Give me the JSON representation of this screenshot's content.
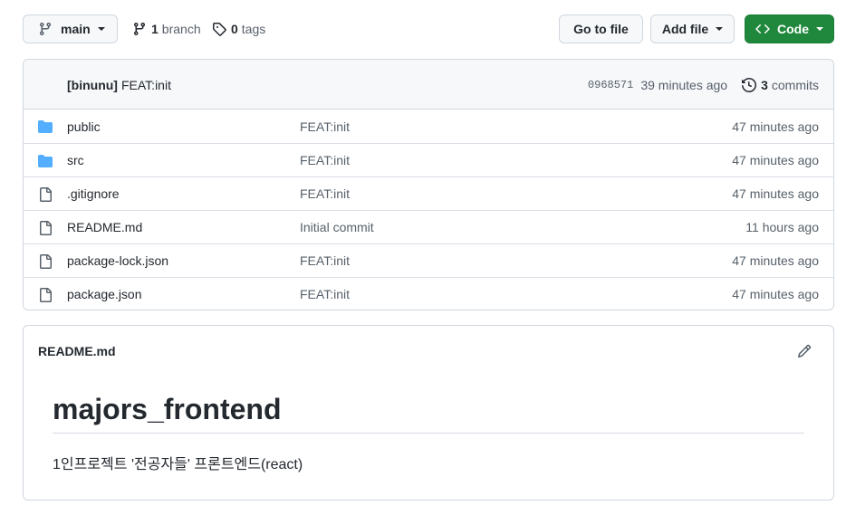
{
  "toolbar": {
    "branch_select": "main",
    "branch_count": "1",
    "branch_label": "branch",
    "tag_count": "0",
    "tag_label": "tags",
    "go_to_file": "Go to file",
    "add_file": "Add file",
    "code": "Code"
  },
  "latest_commit": {
    "author": "[binunu]",
    "message": "FEAT:init",
    "hash": "0968571",
    "time": "39 minutes ago",
    "commit_count": "3",
    "commit_label": "commits"
  },
  "files": [
    {
      "name": "public",
      "type": "folder",
      "icon": "folder-icon",
      "message": "FEAT:init",
      "age": "47 minutes ago"
    },
    {
      "name": "src",
      "type": "folder",
      "icon": "folder-icon",
      "message": "FEAT:init",
      "age": "47 minutes ago"
    },
    {
      "name": ".gitignore",
      "type": "file",
      "icon": "file-icon",
      "message": "FEAT:init",
      "age": "47 minutes ago"
    },
    {
      "name": "README.md",
      "type": "file",
      "icon": "file-icon",
      "message": "Initial commit",
      "age": "11 hours ago"
    },
    {
      "name": "package-lock.json",
      "type": "file",
      "icon": "file-icon",
      "message": "FEAT:init",
      "age": "47 minutes ago"
    },
    {
      "name": "package.json",
      "type": "file",
      "icon": "file-icon",
      "message": "FEAT:init",
      "age": "47 minutes ago"
    }
  ],
  "readme": {
    "filename": "README.md",
    "heading": "majors_frontend",
    "body": "1인프로젝트 '전공자들' 프론트엔드(react)"
  },
  "colors": {
    "code_button": "#1f883d",
    "folder": "#54aeff",
    "border": "#d0d7de"
  }
}
